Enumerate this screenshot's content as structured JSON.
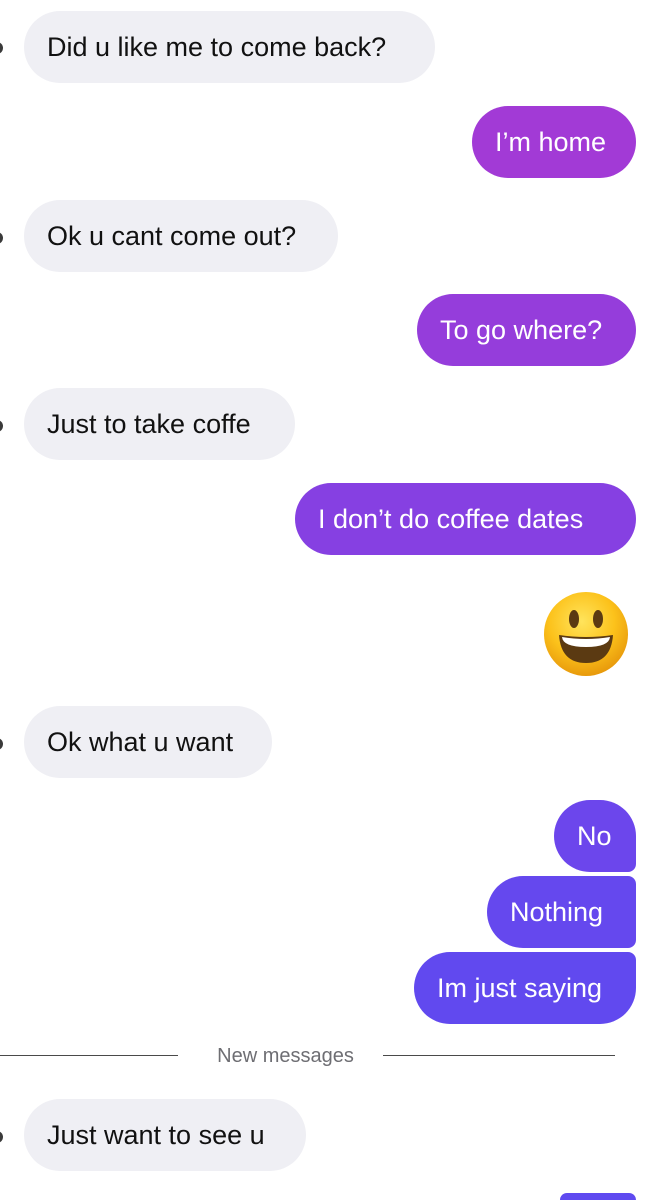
{
  "messages": [
    {
      "side": "in",
      "text": "Did u like me to come back?"
    },
    {
      "side": "out",
      "text": "I’m home"
    },
    {
      "side": "in",
      "text": "Ok u cant come out?"
    },
    {
      "side": "out",
      "text": "To go where?"
    },
    {
      "side": "in",
      "text": "Just to take coffe"
    },
    {
      "side": "out",
      "text": "I don’t do coffee dates"
    },
    {
      "side": "out",
      "emoji": "smiling-face-icon"
    },
    {
      "side": "in",
      "text": "Ok what u want"
    },
    {
      "side": "out",
      "text": "No"
    },
    {
      "side": "out",
      "text": "Nothing"
    },
    {
      "side": "out",
      "text": "Im just saying"
    },
    {
      "side": "in",
      "text": "Just want to see u"
    }
  ],
  "divider": {
    "label": "New messages"
  },
  "colors": {
    "incoming_bubble": "#efeff4",
    "incoming_text": "#111111",
    "outgoing_text": "#ffffff",
    "outgoing_gradient": [
      "#a23ad6",
      "#8a3ee0",
      "#7a42e8",
      "#6c46ec",
      "#6248ee"
    ]
  }
}
